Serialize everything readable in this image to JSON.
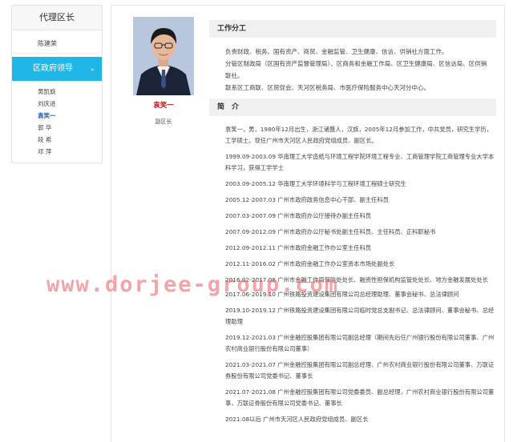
{
  "sidebar": {
    "title": "代理区长",
    "top_item": "陈建荣",
    "group": {
      "label": "区政府领导",
      "chevron": "⌄"
    },
    "members": [
      "黄凯旋",
      "刘庆进",
      "袁笑一",
      "郭  华",
      "段  希",
      "邓  萍"
    ]
  },
  "profile": {
    "name": "袁笑一",
    "title": "副区长"
  },
  "duties": {
    "heading": "工作分工",
    "lines": [
      "负责财政、税务、国有资产、商贸、金融监管、卫生健康、信访、供销社方面工作。",
      "分管区财政局（区国有资产监督管理局）、区商务和金融工作局、区卫生健康局、区信访局、区供销联社。",
      "联系区工商联、区贸促会、天河区税务局、市医疗保险服务中心天河分中心。"
    ]
  },
  "intro": {
    "heading": "简　介",
    "paragraphs": [
      "袁笑一，男，1980年12月出生，浙江诸暨人，汉族，2005年12月参加工作，中共党员，研究生学历，工学硕士。现任广州市天河区人民政府党组成员、副区长。",
      "1999.09-2003.09  华南理工大学造纸与环境工程学院环境工程专业、工商管理学院工商管理专业大学本科学习，获得工学学士",
      "2003.09-2005.12  华南理工大学环境科学与工程环境工程硕士研究生",
      "2005.12-2007.03  广州市政府政务信息中心干部、副主任科员",
      "2007.03-2007.09  广州市政府办公厅接待办副主任科员",
      "2007.09-2012.09  广州市政府办公厅秘书处副主任科员、主任科员、正科职秘书",
      "2012.09-2012.11  广州市政府金融工作办公室主任科员",
      "2012.11-2016.02  广州市政府金融工作办公室资本市场处副处长",
      "2016.02-2017.06  广州市金融工作局保险处处长、融资性担保机构监管处处长、地方金融发展处处长",
      "2017.06-2019.10  广州铁路投资建设集团有限公司总经理助理、董事会秘书、总法律顾问",
      "2019.10-2019.12  广州铁路投资建设集团有限公司临时党总支副书记、总法律顾问、董事会秘书、总经理助理",
      "2019.12-2021.03  广州金融控股集团有限公司副总经理（期间先后任广州银行股份有限公司董事、广州农村商业银行股份有限公司董事）",
      "2021.03-2021.07  广州金融控股集团有限公司副总经理、广州农村商业银行股份有限公司董事、万联证券股份有限公司党委书记、董事长",
      "2021.07-2021.08  广州金融控股集团有限公司党委委员、副总经理，广州农村商业银行股份有限公司董事，万联证券股份有限公司党委书记、董事长",
      "2021.08以后        广州市天河区人民政府党组成员、副区长"
    ]
  },
  "watermark": "www.dorjee-group.com"
}
